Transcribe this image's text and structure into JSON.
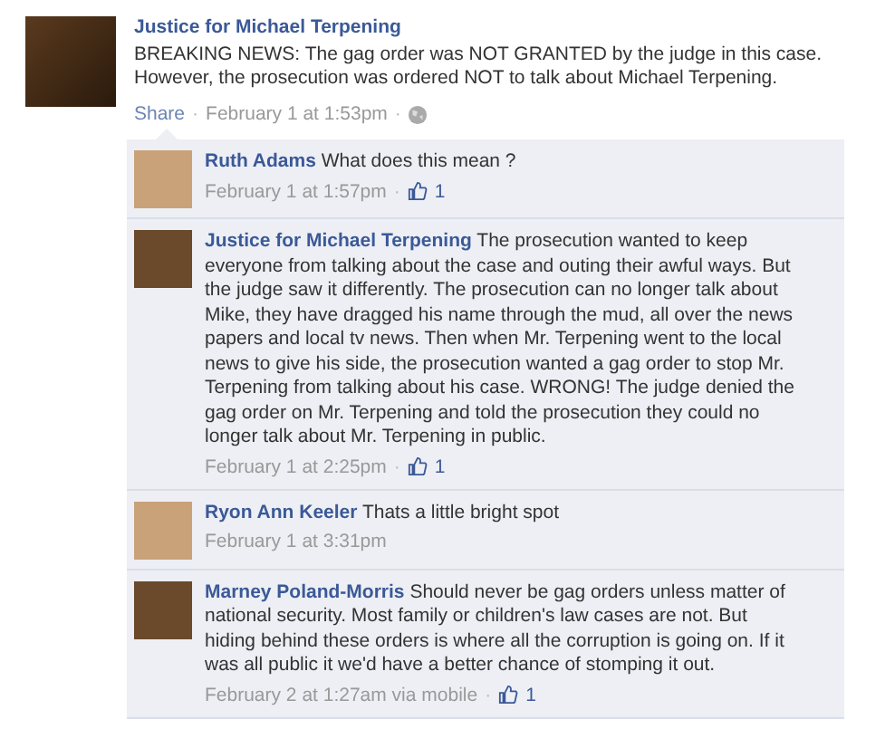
{
  "post": {
    "author": "Justice for Michael Terpening",
    "text": "BREAKING NEWS: The gag order was NOT GRANTED by the judge in this case. However, the prosecution was ordered NOT to talk about Michael Terpening.",
    "share_link": "Share",
    "separator_1": "·",
    "time": "February 1 at 1:53pm",
    "separator_2": "·"
  },
  "comments": [
    {
      "author": "Ruth Adams",
      "text": "What does this mean ?",
      "time": "February 1 at 1:57pm",
      "separator": "·",
      "likes": "1"
    },
    {
      "author": "Justice for Michael Terpening",
      "text": "The prosecution wanted to keep everyone from talking about the case and outing their awful ways. But the judge saw it differently. The prosecution can no longer talk about Mike, they have dragged his name through the mud, all over the news papers and local tv news. Then when Mr. Terpening went to the local news to give his side, the prosecution wanted a gag order to stop Mr. Terpening from talking about his case. WRONG! The judge denied the gag order on Mr. Terpening and told the prosecution they could no longer talk about Mr. Terpening in public.",
      "time": "February 1 at 2:25pm",
      "separator": "·",
      "likes": "1"
    },
    {
      "author": "Ryon Ann Keeler",
      "text": "Thats a little bright spot",
      "time": "February 1 at 3:31pm"
    },
    {
      "author": "Marney Poland-Morris",
      "text": "Should never be gag orders unless matter of national security. Most family or children's law cases are not. But hiding behind these orders is where all the corruption is going on. If it was all public it we'd have a better chance of stomping it out.",
      "time": "February 2 at 1:27am via mobile",
      "separator": "·",
      "likes": "1"
    }
  ]
}
